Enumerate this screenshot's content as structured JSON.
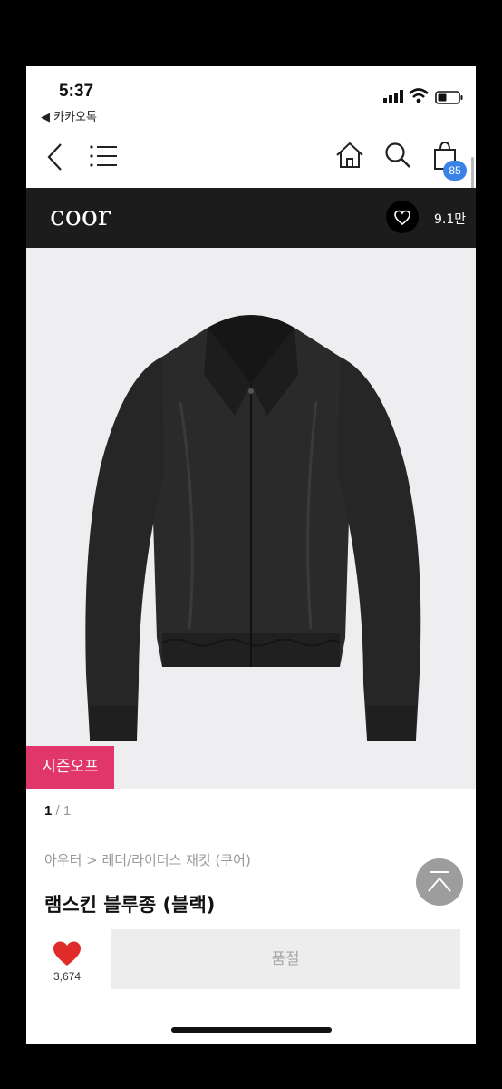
{
  "status_bar": {
    "time": "5:37",
    "back_app": "◀ 카카오톡"
  },
  "nav": {
    "cart_count": "85"
  },
  "brand": {
    "name": "coor",
    "likes": "9.1만"
  },
  "product": {
    "sale_tag": "시즌오프",
    "pager_current": "1",
    "pager_total": " / 1",
    "breadcrumb": "아우터 > 레더/라이더스 재킷 (쿠어)",
    "title": "램스킨 블루종 (블랙)"
  },
  "bottom_bar": {
    "like_count": "3,674",
    "buy_label": "품절"
  },
  "colors": {
    "brand_bg": "#1c1c1c",
    "sale_tag": "#e0366a",
    "badge": "#3b82e6",
    "heart": "#e02b2b"
  },
  "icons": [
    "back-icon",
    "menu-icon",
    "home-icon",
    "search-icon",
    "cart-icon",
    "heart-icon",
    "scroll-top-icon"
  ]
}
